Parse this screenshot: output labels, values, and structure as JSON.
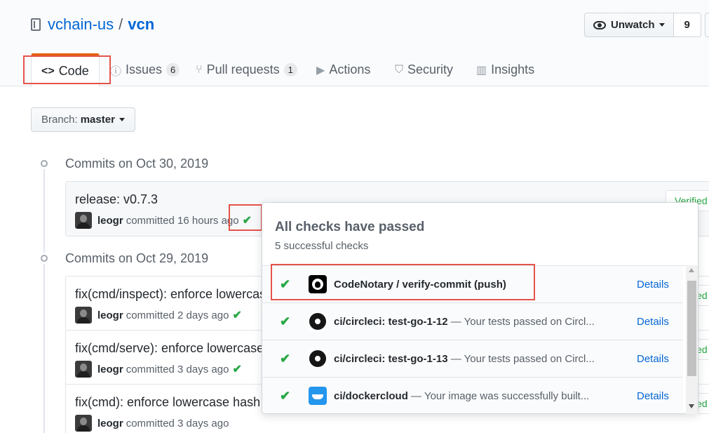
{
  "repo": {
    "owner": "vchain-us",
    "separator": "/",
    "name": "vcn"
  },
  "watch": {
    "label": "Unwatch",
    "count": "9"
  },
  "tabs": [
    {
      "label": "Code",
      "icon": "code-icon"
    },
    {
      "label": "Issues",
      "count": "6",
      "icon": "issue-icon"
    },
    {
      "label": "Pull requests",
      "count": "1",
      "icon": "pull-request-icon"
    },
    {
      "label": "Actions",
      "icon": "play-icon"
    },
    {
      "label": "Security",
      "icon": "shield-icon"
    },
    {
      "label": "Insights",
      "icon": "graph-icon"
    }
  ],
  "branch": {
    "prefix": "Branch:",
    "name": "master"
  },
  "groups": [
    {
      "title": "Commits on Oct 30, 2019",
      "commits": [
        {
          "message": "release: v0.7.3",
          "author": "leogr",
          "action": "committed 16 hours ago",
          "check": "✔"
        }
      ]
    },
    {
      "title": "Commits on Oct 29, 2019",
      "commits": [
        {
          "message": "fix(cmd/inspect): enforce lowercas",
          "author": "leogr",
          "action": "committed 2 days ago",
          "check": "✔"
        },
        {
          "message": "fix(cmd/serve): enforce lowercase",
          "author": "leogr",
          "action": "committed 3 days ago",
          "check": "✔"
        },
        {
          "message": "fix(cmd): enforce lowercase hash s",
          "author": "leogr",
          "action": "committed 3 days ago",
          "check": ""
        }
      ]
    }
  ],
  "verified_label": "Verified",
  "checks_popover": {
    "title": "All checks have passed",
    "subtitle": "5 successful checks",
    "checks": [
      {
        "name": "CodeNotary / verify-commit (push)",
        "description": "",
        "details": "Details",
        "icon": "github-icon"
      },
      {
        "name": "ci/circleci: test-go-1-12",
        "description": " — Your tests passed on Circl...",
        "details": "Details",
        "icon": "circleci-icon"
      },
      {
        "name": "ci/circleci: test-go-1-13",
        "description": " — Your tests passed on Circl...",
        "details": "Details",
        "icon": "circleci-icon"
      },
      {
        "name": "ci/dockercloud",
        "description": " — Your image was successfully built...",
        "details": "Details",
        "icon": "docker-icon"
      }
    ]
  },
  "colors": {
    "accent": "#0366d6",
    "success": "#28a745",
    "tab_border": "#e36209",
    "highlight_box": "#e5534b"
  }
}
